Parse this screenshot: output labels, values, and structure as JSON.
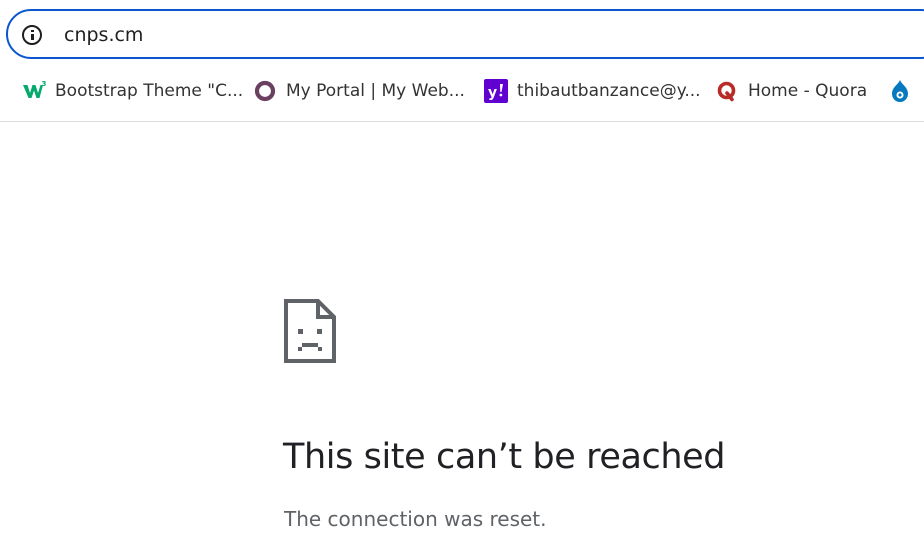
{
  "omnibox": {
    "url": "cnps.cm",
    "icon": "info-icon",
    "border_color": "#0b57d0"
  },
  "bookmarks": [
    {
      "label": "Bootstrap Theme \"C...",
      "icon": "w3schools-icon",
      "color": "#04aa6d"
    },
    {
      "label": "My Portal | My Web...",
      "icon": "portal-ring-icon",
      "color": "#6b3f5f"
    },
    {
      "label": "thibautbanzance@y...",
      "icon": "yahoo-icon",
      "color": "#6001d2"
    },
    {
      "label": "Home - Quora",
      "icon": "quora-icon",
      "color": "#b92b27"
    },
    {
      "label": "",
      "icon": "drupal-icon",
      "color": "#0678be"
    }
  ],
  "error": {
    "icon": "sad-page-icon",
    "title": "This site can’t be reached",
    "description": "The connection was reset."
  }
}
